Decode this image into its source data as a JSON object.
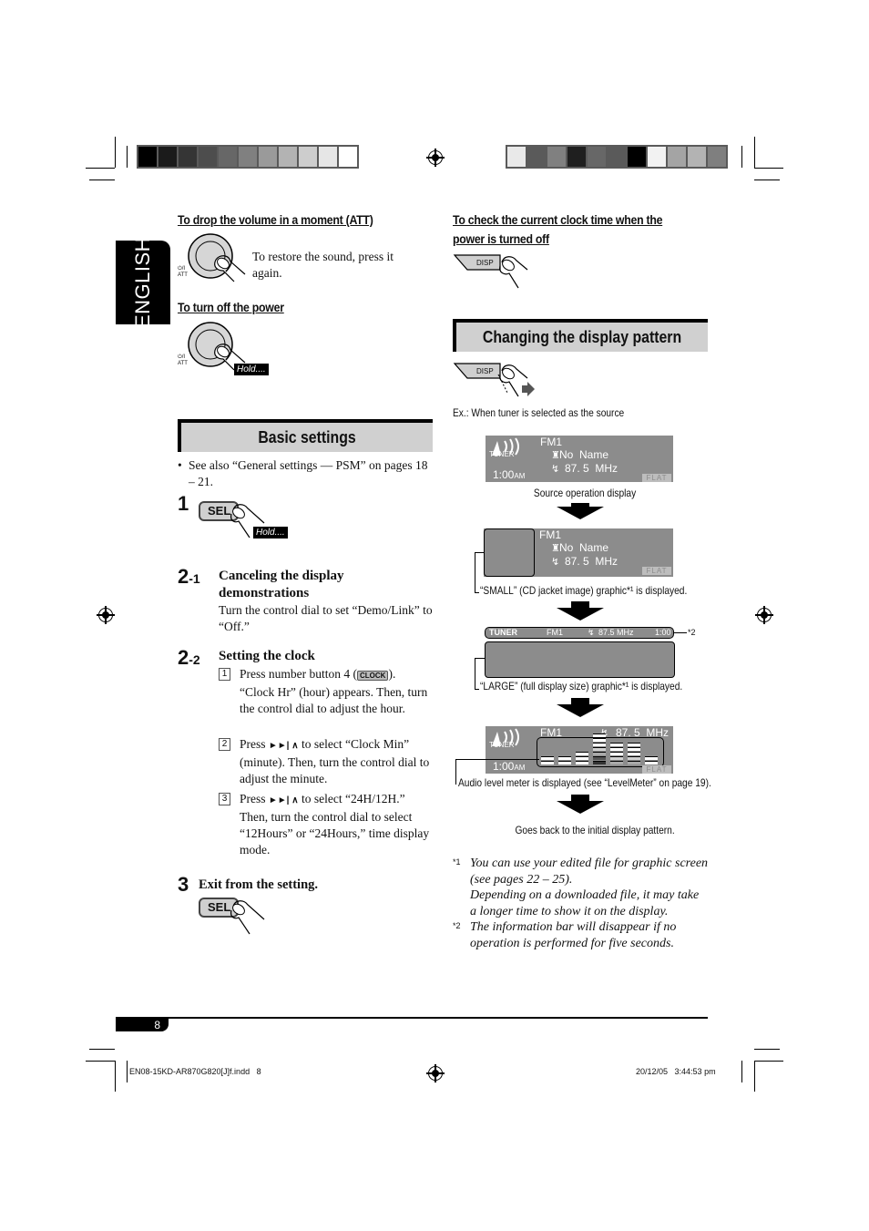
{
  "print_marks": {
    "left_color_bar": [
      "#000000",
      "#1b1b1b",
      "#353535",
      "#4d4d4d",
      "#676767",
      "#808080",
      "#9a9a9a",
      "#b3b3b3",
      "#cdcdcd",
      "#e6e6e6",
      "#ffffff"
    ],
    "right_color_bar": [
      "#e9e9e9",
      "#5a5a5a",
      "#808080",
      "#1f1f1f",
      "#676767",
      "#5a5a5a",
      "#000000",
      "#f2f2f2",
      "#a4a4a4",
      "#b3b3b3",
      "#7f7f7f"
    ]
  },
  "language_tab": "ENGLISH",
  "left_column": {
    "att": {
      "heading": "To drop the volume in a moment (ATT)",
      "button_label_top": "⏻/I",
      "button_label_bottom": "ATT",
      "text": "To restore the sound, press it again."
    },
    "power_off": {
      "heading": "To turn off the power",
      "button_label_top": "⏻/I",
      "button_label_bottom": "ATT",
      "hold_label": "Hold...."
    },
    "basic_settings": {
      "heading": "Basic settings",
      "bullet": "See also “General settings — PSM” on pages 18 – 21.",
      "step1": {
        "number": "1",
        "button": "SEL",
        "hold_label": "Hold...."
      },
      "step2_1": {
        "number": "2",
        "sub": "-1",
        "title": "Canceling the display demonstrations",
        "text": "Turn the control dial to set “Demo/Link” to “Off.”"
      },
      "step2_2": {
        "number": "2",
        "sub": "-2",
        "title": "Setting the clock",
        "items": [
          {
            "num": "1",
            "pre": "Press number button 4 (",
            "key": "CLOCK",
            "post": "). “Clock Hr” (hour) appears. Then, turn the control dial to adjust the hour."
          },
          {
            "num": "2",
            "pre": "Press ",
            "key": "►►| ∧",
            "post": " to select “Clock Min” (minute). Then, turn the control dial to adjust the minute."
          },
          {
            "num": "3",
            "pre": "Press ",
            "key": "►►| ∧",
            "post": " to select “24H/12H.” Then, turn the control dial to select “12Hours” or “24Hours,” time display mode."
          }
        ]
      },
      "step3": {
        "number": "3",
        "title": "Exit from the setting.",
        "button": "SEL"
      }
    }
  },
  "right_column": {
    "clock_check": {
      "heading_line1": "To check the current clock time when the",
      "heading_line2": "power is turned off",
      "button": "DISP"
    },
    "display_pattern": {
      "heading": "Changing the display pattern",
      "button": "DISP",
      "example": "Ex.: When tuner is selected as the source",
      "lcd": {
        "source_icon": "TUNER",
        "band": "FM1",
        "station": "No  Name",
        "frequency": "87. 5  MHz",
        "time": "1:00",
        "ampm": "AM",
        "eq": "FLAT"
      },
      "info_bar": {
        "source": "TUNER",
        "band": "FM1",
        "frequency": "87.5 MHz",
        "time": "1:00",
        "note": "*2"
      },
      "captions": {
        "source_display": "Source operation display",
        "small": "“SMALL” (CD jacket image) graphic*¹ is displayed.",
        "large": "“LARGE” (full display size) graphic*¹ is displayed.",
        "level_meter": "Audio level meter is displayed (see “LevelMeter” on page 19).",
        "back": "Goes back to the initial display pattern."
      },
      "level_meter_bars": [
        2,
        2,
        3,
        7,
        5,
        5,
        2
      ]
    },
    "footnotes": [
      {
        "mark": "*1",
        "lines": [
          "You can use your edited file for graphic screen",
          "(see pages 22 – 25).",
          "Depending on a downloaded file, it may take",
          "a longer time to show it on the display."
        ]
      },
      {
        "mark": "*2",
        "lines": [
          "The information bar will disappear if no",
          "operation is performed for five seconds."
        ]
      }
    ]
  },
  "footer": {
    "page_number": "8",
    "file_name": "EN08-15KD-AR870G820[J]f.indd   8",
    "timestamp": "20/12/05   3:44:53 pm"
  }
}
